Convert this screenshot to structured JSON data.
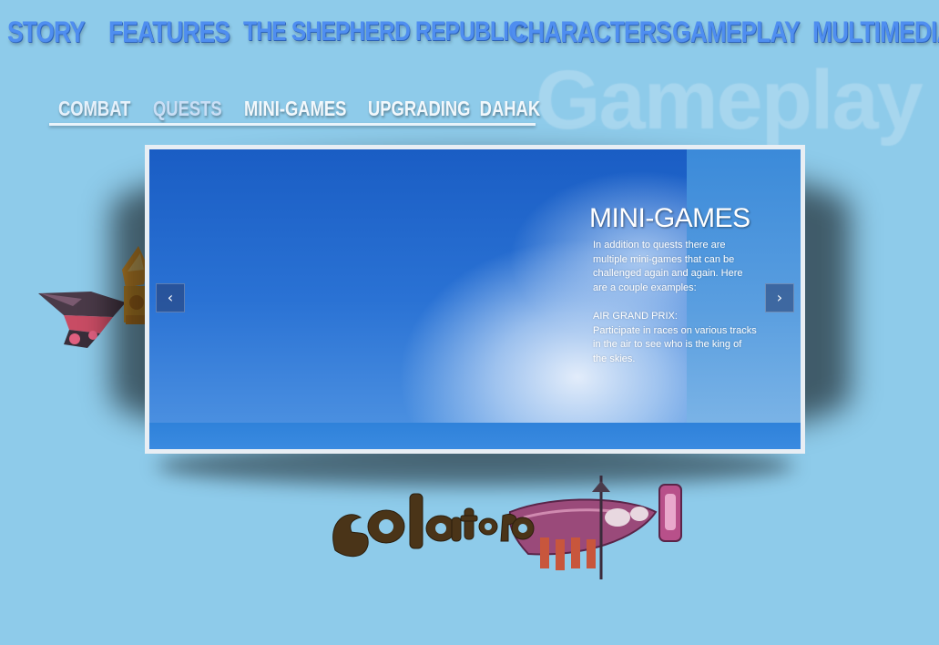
{
  "nav": {
    "items": [
      {
        "label": "STORY"
      },
      {
        "label": "FEATURES"
      },
      {
        "label": "THE SHEPHERD REPUBLIC"
      },
      {
        "label": "CHARACTERS"
      },
      {
        "label": "GAMEPLAY"
      },
      {
        "label": "MULTIMEDIA"
      }
    ]
  },
  "watermark": "Gameplay",
  "sub_tabs": {
    "items": [
      {
        "label": "COMBAT"
      },
      {
        "label": "QUESTS"
      },
      {
        "label": "MINI-GAMES"
      },
      {
        "label": "UPGRADING  DAHAK"
      }
    ],
    "active": "MINI-GAMES"
  },
  "slide": {
    "title": "MINI-GAMES",
    "intro": "In addition to quests there are multiple mini-games that can be challenged again and again. Here are a couple examples:",
    "example_heading": "AIR GRAND PRIX:",
    "example_text": "Participate in races on various tracks in the air to see who is the king of the skies.",
    "prev_icon": "chevron-left-icon",
    "next_icon": "chevron-right-icon",
    "prev_glyph": "‹",
    "next_glyph": "›"
  },
  "logo": {
    "text": "Solatorobo"
  },
  "colors": {
    "background": "#8ecbea",
    "nav_text": "#4f8ef0",
    "slide_blue": "#2d7fdc"
  }
}
